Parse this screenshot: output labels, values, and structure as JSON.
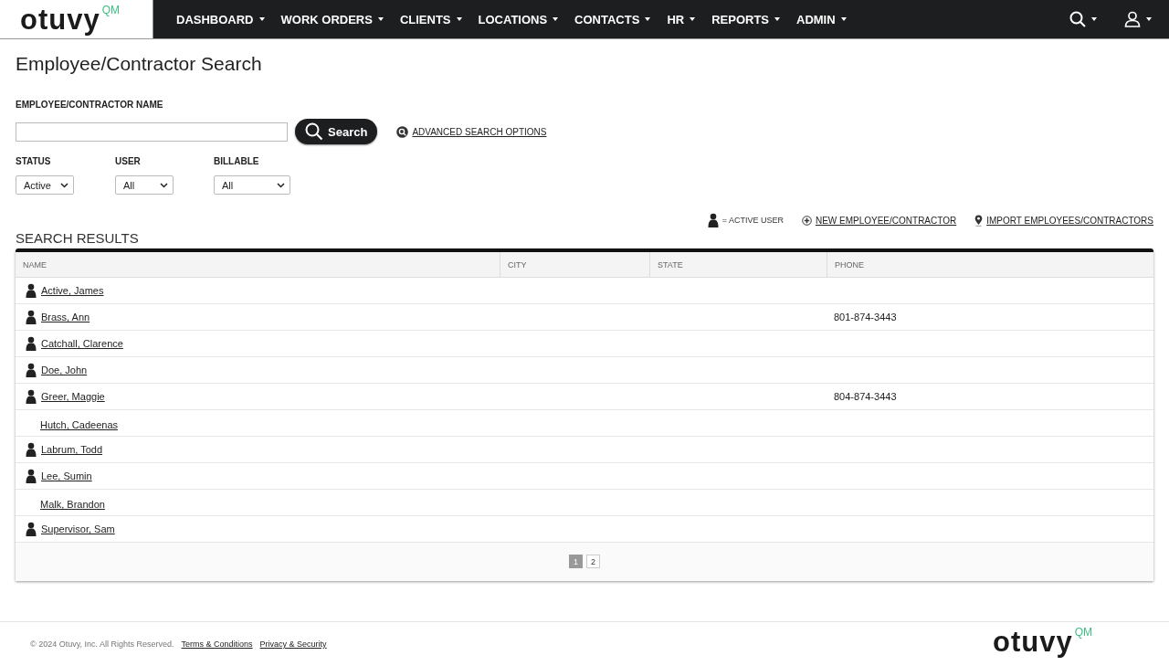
{
  "logo": {
    "wordmark": "otuvy",
    "suffix": "QM"
  },
  "nav": [
    {
      "label": "DASHBOARD"
    },
    {
      "label": "WORK ORDERS"
    },
    {
      "label": "CLIENTS"
    },
    {
      "label": "LOCATIONS"
    },
    {
      "label": "CONTACTS"
    },
    {
      "label": "HR"
    },
    {
      "label": "REPORTS"
    },
    {
      "label": "ADMIN"
    }
  ],
  "page_title": "Employee/Contractor Search",
  "name_field": {
    "label": "EMPLOYEE/CONTRACTOR NAME"
  },
  "search_button": "Search",
  "advanced_link": "ADVANCED SEARCH OPTIONS",
  "filters": [
    {
      "label": "STATUS",
      "value": "Active"
    },
    {
      "label": "USER",
      "value": "All"
    },
    {
      "label": "BILLABLE",
      "value": "All"
    }
  ],
  "legend": "= ACTIVE USER",
  "actions": [
    {
      "kind": "new",
      "label": "NEW EMPLOYEE/CONTRACTOR"
    },
    {
      "kind": "import",
      "label": "IMPORT EMPLOYEES/CONTRACTORS"
    }
  ],
  "results": {
    "title": "SEARCH RESULTS",
    "columns": [
      "NAME",
      "CITY",
      "STATE",
      "PHONE"
    ],
    "rows": [
      {
        "name": "Active, James",
        "active_user": true,
        "phone": ""
      },
      {
        "name": "Brass, Ann",
        "active_user": true,
        "phone": "801-874-3443"
      },
      {
        "name": "Catchall, Clarence",
        "active_user": true,
        "phone": ""
      },
      {
        "name": "Doe, John",
        "active_user": true,
        "phone": ""
      },
      {
        "name": "Greer, Maggie",
        "active_user": true,
        "phone": "804-874-3443"
      },
      {
        "name": "Hutch, Cadeenas",
        "active_user": false,
        "phone": ""
      },
      {
        "name": "Labrum, Todd",
        "active_user": true,
        "phone": ""
      },
      {
        "name": "Lee, Sumin",
        "active_user": true,
        "phone": ""
      },
      {
        "name": "Malk, Brandon",
        "active_user": false,
        "phone": ""
      },
      {
        "name": "Supervisor, Sam",
        "active_user": true,
        "phone": ""
      }
    ],
    "pages": [
      {
        "label": "1",
        "selected": true
      },
      {
        "label": "2",
        "selected": false
      }
    ]
  },
  "footer": {
    "logo": {
      "wordmark": "otuvy",
      "suffix": "QM"
    },
    "copyright": "© 2024 Otuvy, Inc. All Rights Reserved.",
    "links": [
      "Terms & Conditions",
      "Privacy & Security"
    ]
  }
}
